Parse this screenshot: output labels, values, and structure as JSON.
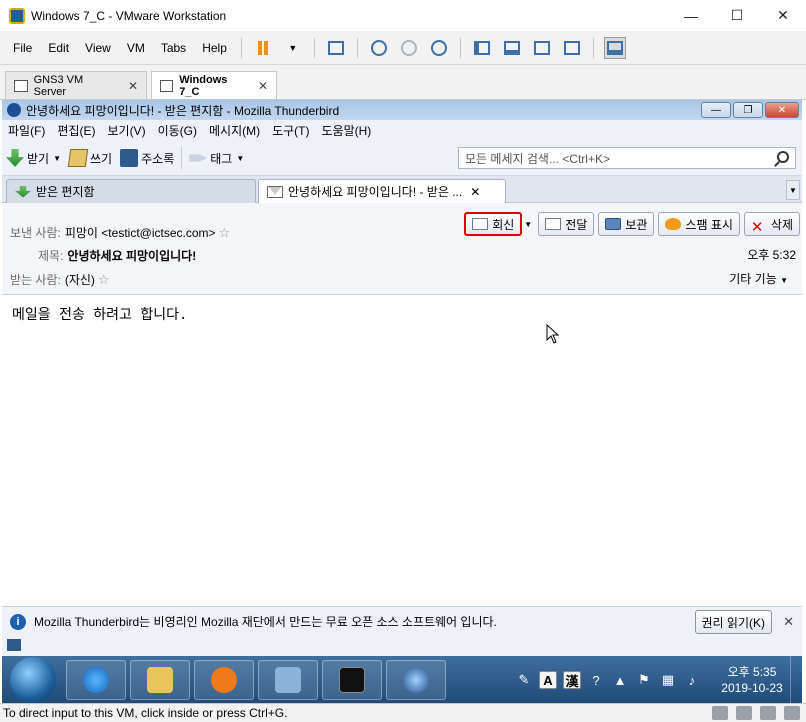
{
  "vmware": {
    "window_title": "Windows 7_C - VMware Workstation",
    "window_buttons": {
      "minimize": "—",
      "maximize": "☐",
      "close": "✕"
    },
    "menus": [
      "File",
      "Edit",
      "View",
      "VM",
      "Tabs",
      "Help"
    ],
    "tabs": [
      {
        "label": "GNS3 VM Server",
        "close": "✕"
      },
      {
        "label": "Windows 7_C",
        "close": "✕"
      }
    ],
    "status_text": "To direct input to this VM, click inside or press Ctrl+G."
  },
  "thunderbird": {
    "window_title": "안녕하세요 피망이입니다! - 받은 편지함 - Mozilla Thunderbird",
    "menus": [
      "파일(F)",
      "편집(E)",
      "보기(V)",
      "이동(G)",
      "메시지(M)",
      "도구(T)",
      "도움말(H)"
    ],
    "toolbar": {
      "get_label": "받기",
      "write_label": "쓰기",
      "address_label": "주소록",
      "tag_label": "태그"
    },
    "search_placeholder": "모든 메세지 검색... <Ctrl+K>",
    "tabs": [
      {
        "label": "받은 편지함"
      },
      {
        "label": "안녕하세요 피망이입니다! - 받은 ...",
        "close": "✕"
      }
    ],
    "message": {
      "from_label": "보낸 사람:",
      "from_value": "피망이 <testict@ictsec.com>",
      "subject_label": "제목:",
      "subject_value": "안녕하세요 피망이입니다!",
      "to_label": "받는 사람:",
      "to_value": "(자신)",
      "time": "오후 5:32",
      "more_label": "기타 기능",
      "body": "메일을 전송 하려고 합니다."
    },
    "actions": {
      "reply": "회신",
      "forward": "전달",
      "archive": "보관",
      "junk": "스팸 표시",
      "delete": "삭제"
    },
    "notification": {
      "text": "Mozilla Thunderbird는 비영리인 Mozilla 재단에서 만드는 무료 오픈 소스 소프트웨어 입니다.",
      "button": "권리 읽기(K)",
      "close": "✕"
    }
  },
  "taskbar": {
    "clock_time": "오후 5:35",
    "clock_date": "2019-10-23",
    "ime_a": "A",
    "ime_han": "漢"
  },
  "colors": {
    "reply_highlight": "#e00000",
    "taskbar": "#2a5a8a"
  }
}
